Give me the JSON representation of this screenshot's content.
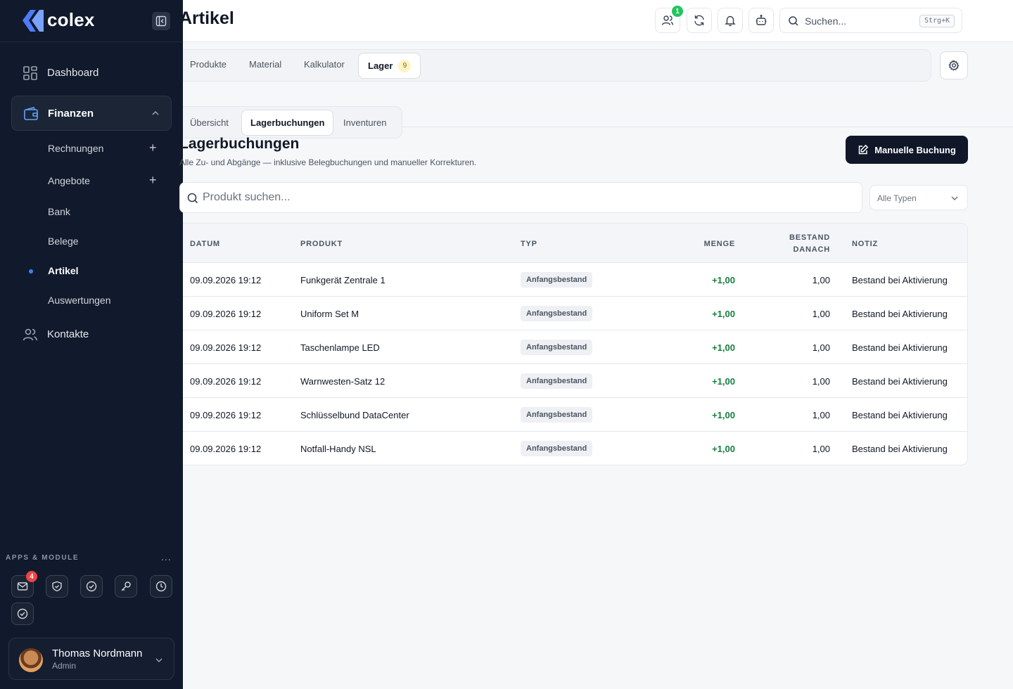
{
  "brand": {
    "name": "colex"
  },
  "page": {
    "title": "Artikel"
  },
  "sidebar": {
    "nav": [
      {
        "label": "Dashboard",
        "icon": "dashboard-icon"
      },
      {
        "label": "Finanzen",
        "icon": "wallet-icon"
      },
      {
        "label": "Kontakte",
        "icon": "users-icon"
      }
    ],
    "finanzen_items": [
      {
        "label": "Rechnungen"
      },
      {
        "label": "Angebote"
      },
      {
        "label": "Bank"
      },
      {
        "label": "Belege"
      },
      {
        "label": "Artikel"
      },
      {
        "label": "Auswertungen"
      }
    ],
    "apps_title": "APPS & MODULE",
    "apps_more": "...",
    "mail_badge": "4",
    "user": {
      "name": "Thomas Nordmann",
      "role": "Admin"
    }
  },
  "topbar": {
    "users_badge": "1",
    "search_placeholder": "Suchen...",
    "search_shortcut": "Strg+K"
  },
  "module_tabs": [
    {
      "label": "Produkte"
    },
    {
      "label": "Material"
    },
    {
      "label": "Kalkulator"
    },
    {
      "label": "Lager",
      "count": "9"
    }
  ],
  "sub_tabs": [
    {
      "label": "Übersicht"
    },
    {
      "label": "Lagerbuchungen"
    },
    {
      "label": "Inventuren"
    }
  ],
  "section": {
    "title": "Lagerbuchungen",
    "description": "Alle Zu- und Abgänge — inklusive Belegbuchungen und manueller Korrekturen.",
    "primary_button": "Manuelle Buchung",
    "product_search_placeholder": "Produkt suchen...",
    "type_filter": "Alle Typen"
  },
  "table": {
    "headers": {
      "datum": "DATUM",
      "produkt": "PRODUKT",
      "typ": "TYP",
      "menge": "MENGE",
      "bestand_1": "BESTAND",
      "bestand_2": "DANACH",
      "notiz": "NOTIZ"
    },
    "rows": [
      {
        "datum": "09.09.2026 19:12",
        "produkt": "Funkgerät Zentrale 1",
        "typ": "Anfangsbestand",
        "menge": "+1,00",
        "bestand": "1,00",
        "notiz": "Bestand bei Aktivierung"
      },
      {
        "datum": "09.09.2026 19:12",
        "produkt": "Uniform Set M",
        "typ": "Anfangsbestand",
        "menge": "+1,00",
        "bestand": "1,00",
        "notiz": "Bestand bei Aktivierung"
      },
      {
        "datum": "09.09.2026 19:12",
        "produkt": "Taschenlampe LED",
        "typ": "Anfangsbestand",
        "menge": "+1,00",
        "bestand": "1,00",
        "notiz": "Bestand bei Aktivierung"
      },
      {
        "datum": "09.09.2026 19:12",
        "produkt": "Warnwesten-Satz 12",
        "typ": "Anfangsbestand",
        "menge": "+1,00",
        "bestand": "1,00",
        "notiz": "Bestand bei Aktivierung"
      },
      {
        "datum": "09.09.2026 19:12",
        "produkt": "Schlüsselbund DataCenter",
        "typ": "Anfangsbestand",
        "menge": "+1,00",
        "bestand": "1,00",
        "notiz": "Bestand bei Aktivierung"
      },
      {
        "datum": "09.09.2026 19:12",
        "produkt": "Notfall-Handy NSL",
        "typ": "Anfangsbestand",
        "menge": "+1,00",
        "bestand": "1,00",
        "notiz": "Bestand bei Aktivierung"
      }
    ]
  },
  "colors": {
    "sidebar_bg": "#111a2c",
    "accent": "#3b82f6",
    "positive": "#15803d",
    "primary_btn": "#0f1729"
  }
}
